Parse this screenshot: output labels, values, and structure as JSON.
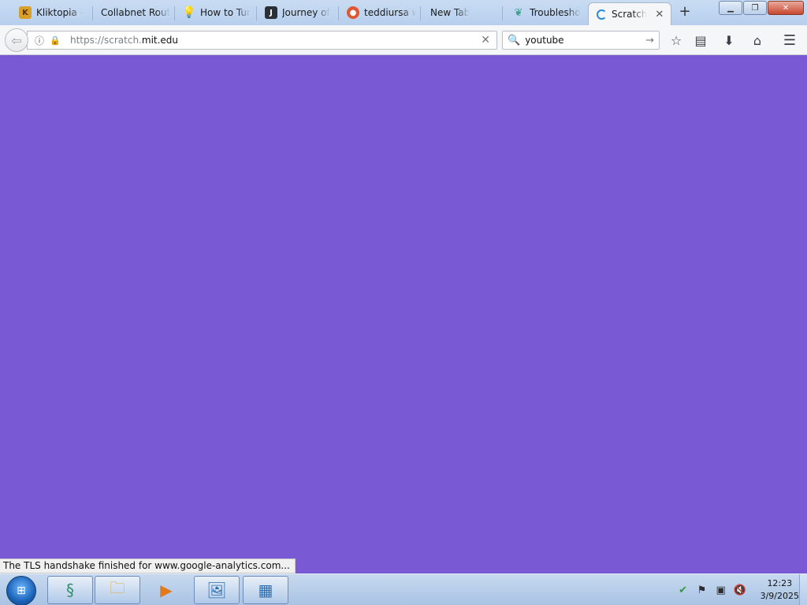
{
  "tabs": [
    {
      "title": "Kliktopia -",
      "favicon": "kliktopia-favicon"
    },
    {
      "title": "Collabnet Route",
      "favicon": ""
    },
    {
      "title": "How to Tur",
      "favicon": "lightbulb-favicon"
    },
    {
      "title": "Journey of",
      "favicon": "j-favicon"
    },
    {
      "title": "teddiursa w",
      "favicon": "duckduckgo-favicon"
    },
    {
      "title": "New Tab",
      "favicon": ""
    },
    {
      "title": "Troublesho",
      "favicon": "leaf-favicon"
    },
    {
      "title": "Scratch",
      "favicon": "loading-spinner",
      "active": true
    }
  ],
  "nav": {
    "url_scheme": "https://scratch.",
    "url_host": "mit.edu",
    "search_value": "youtube"
  },
  "content": {
    "background": "#7a5ad4"
  },
  "status": {
    "text": "The TLS handshake finished for www.google-analytics.com..."
  },
  "taskbar": {
    "apps": [
      "snake-app",
      "file-explorer",
      "media-player",
      "photo-viewer",
      "control-panel"
    ]
  },
  "clock": {
    "time": "12:23",
    "date": "3/9/2025"
  }
}
